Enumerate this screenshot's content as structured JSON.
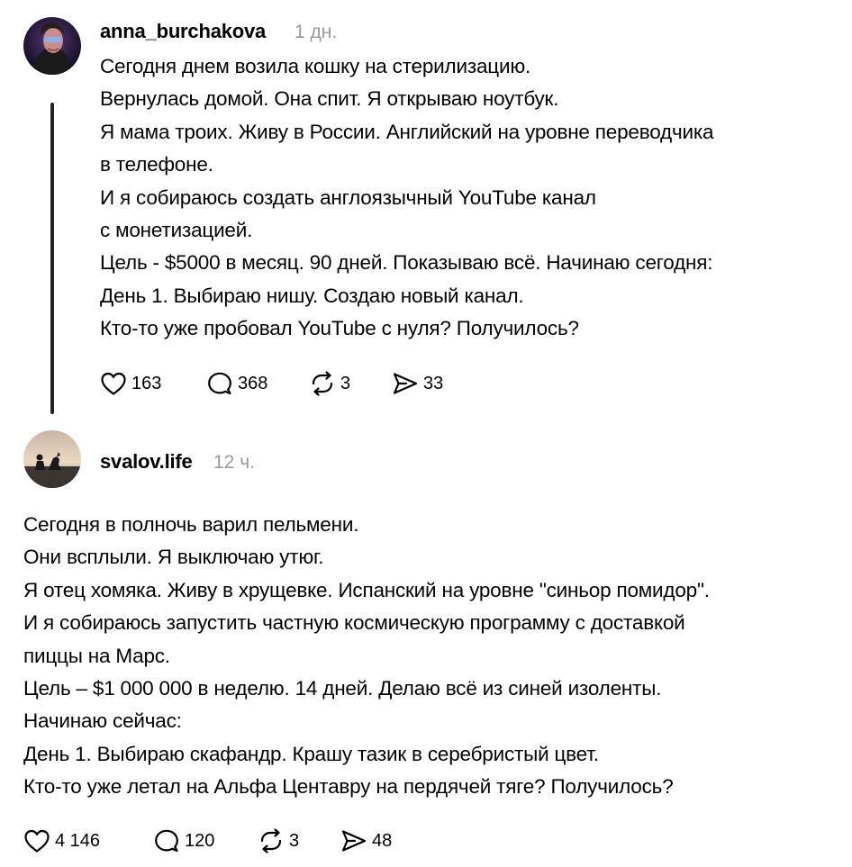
{
  "post1": {
    "username": "anna_burchakova",
    "time": "1 дн.",
    "lines": [
      "Сегодня днем возила кошку на стерилизацию.",
      "Вернулась домой. Она спит. Я открываю ноутбук.",
      "Я мама троих. Живу в России. Английский на уровне переводчика",
      "в телефоне.",
      "И я собираюсь создать англоязычный YouTube канал",
      "с монетизацией.",
      "Цель - $5000 в месяц. 90 дней. Показываю всё. Начинаю сегодня:",
      "День 1. Выбираю нишу. Создаю новый канал.",
      "Кто-то уже пробовал YouTube с нуля? Получилось?"
    ],
    "likes": "163",
    "comments": "368",
    "reposts": "3",
    "shares": "33"
  },
  "post2": {
    "username": "svalov.life",
    "time": "12 ч.",
    "lines": [
      "Сегодня в полночь варил пельмени.",
      "Они всплыли. Я выключаю утюг.",
      "Я отец хомяка. Живу в хрущевке. Испанский на уровне \"синьор помидор\".",
      "И я собираюсь запустить частную космическую программу с доставкой",
      "пиццы на Марс.",
      "Цель – $1 000 000 в неделю. 14 дней. Делаю всё из синей изоленты.",
      "Начинаю сейчас:",
      "День 1. Выбираю скафандр. Крашу тазик в серебристый цвет.",
      "Кто-то уже летал на Альфа Центавру на пердячей тяге? Получилось?"
    ],
    "likes": "4 146",
    "comments": "120",
    "reposts": "3",
    "shares": "48"
  },
  "icons": {
    "like": "heart-icon",
    "comment": "comment-bubble-icon",
    "repost": "repost-icon",
    "share": "send-icon"
  },
  "colors": {
    "text": "#000000",
    "muted": "#9a9a9a",
    "thread_line": "#222222"
  }
}
